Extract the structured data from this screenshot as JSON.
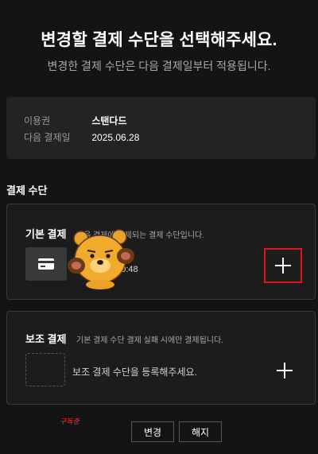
{
  "header": {
    "title": "변경할 결제 수단을 선택해주세요.",
    "subtitle": "변경한 결제 수단은 다음 결제일부터 적용됩니다."
  },
  "subscription": {
    "plan_label": "이용권",
    "plan_value": "스탠다드",
    "next_payment_label": "다음 결제일",
    "next_payment_value": "2025.06.28"
  },
  "payment_section": {
    "title": "결제 수단",
    "primary": {
      "label": "기본 결제",
      "description": "다음 결제에 결제되는 결제 수단입니다.",
      "card_info": "25-05-28 10:48",
      "icon": "credit-card-icon"
    },
    "secondary": {
      "label": "보조 결제",
      "description": "기본 결제 수단 결제 실패 시에만 결제됩니다.",
      "empty_text": "보조 결제 수단을 등록해주세요."
    }
  },
  "buttons": {
    "change": "변경",
    "cancel": "해지"
  },
  "annotation": {
    "mark_text": "구독중"
  },
  "colors": {
    "background": "#141414",
    "card": "#232323",
    "highlight": "#e4141b"
  }
}
